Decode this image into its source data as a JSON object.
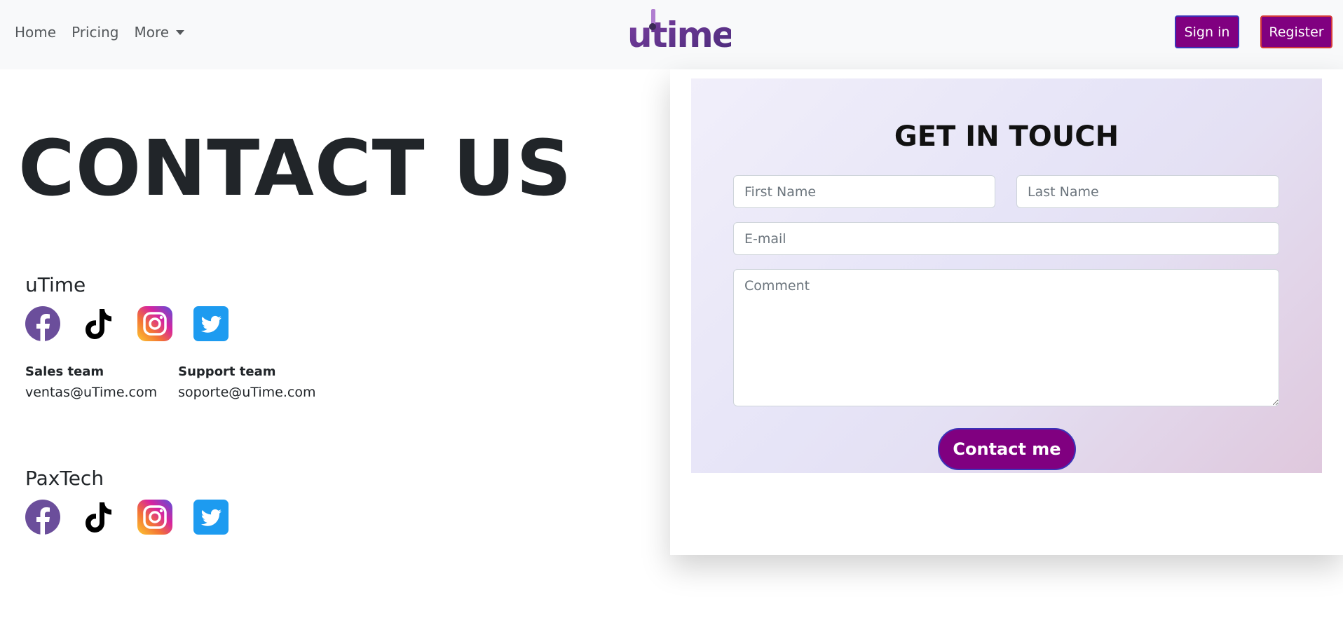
{
  "nav": {
    "home": "Home",
    "pricing": "Pricing",
    "more": "More",
    "logo_text": "utime",
    "sign_in": "Sign in",
    "register": "Register"
  },
  "hero": {
    "title": "CONTACT US"
  },
  "companies": [
    {
      "name": "uTime",
      "socials": [
        "facebook-icon",
        "tiktok-icon",
        "instagram-icon",
        "twitter-icon"
      ]
    },
    {
      "name": "PaxTech",
      "socials": [
        "facebook-icon",
        "tiktok-icon",
        "instagram-icon",
        "twitter-icon"
      ]
    }
  ],
  "teams": [
    {
      "title": "Sales team",
      "email": "ventas@uTime.com"
    },
    {
      "title": "Support team",
      "email": "soporte@uTime.com"
    }
  ],
  "form": {
    "title": "GET IN TOUCH",
    "first_name_placeholder": "First Name",
    "last_name_placeholder": "Last Name",
    "email_placeholder": "E-mail",
    "comment_placeholder": "Comment",
    "submit_label": "Contact me"
  },
  "colors": {
    "brand": "#800080",
    "navbar_bg": "#f8f9fa",
    "facebook": "#6b4e9b",
    "twitter": "#1d9bf0"
  }
}
